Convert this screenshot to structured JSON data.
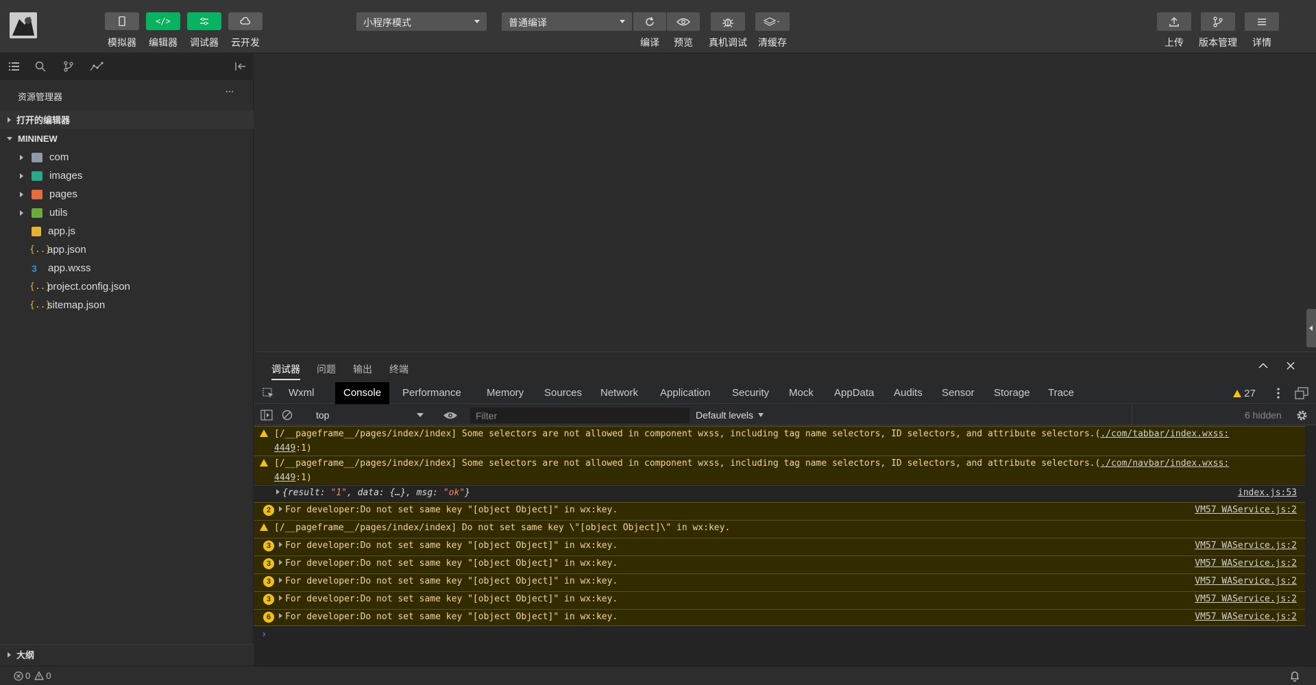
{
  "toolbar": {
    "left_buttons": [
      {
        "label": "模拟器",
        "icon": "phone-icon"
      },
      {
        "label": "编辑器",
        "icon": "code-icon"
      },
      {
        "label": "调试器",
        "icon": "debug-icon"
      },
      {
        "label": "云开发",
        "icon": "cloud-icon"
      }
    ],
    "mode_select": "小程序模式",
    "compile_select": "普通编译",
    "center_buttons": [
      {
        "label": "编译",
        "icon": "refresh-icon"
      },
      {
        "label": "预览",
        "icon": "eye-icon"
      },
      {
        "label": "真机调试",
        "icon": "bug-icon"
      },
      {
        "label": "清缓存",
        "icon": "layers-icon"
      }
    ],
    "right_buttons": [
      {
        "label": "上传",
        "icon": "upload-icon"
      },
      {
        "label": "版本管理",
        "icon": "branch-icon"
      },
      {
        "label": "详情",
        "icon": "menu-icon"
      }
    ]
  },
  "sidebar": {
    "title": "资源管理器",
    "more": "···",
    "open_editors": "打开的编辑器",
    "project": "MININEW",
    "items": [
      {
        "name": "com",
        "type": "folder"
      },
      {
        "name": "images",
        "type": "folder"
      },
      {
        "name": "pages",
        "type": "folder"
      },
      {
        "name": "utils",
        "type": "folder"
      },
      {
        "name": "app.js",
        "type": "js"
      },
      {
        "name": "app.json",
        "type": "json"
      },
      {
        "name": "app.wxss",
        "type": "wxss"
      },
      {
        "name": "project.config.json",
        "type": "json"
      },
      {
        "name": "sitemap.json",
        "type": "json"
      }
    ],
    "outline": "大纲"
  },
  "devtools": {
    "top_tabs": [
      "调试器",
      "问题",
      "输出",
      "终端"
    ],
    "tabs": [
      "Wxml",
      "Console",
      "Performance",
      "Memory",
      "Sources",
      "Network",
      "Application",
      "Security",
      "Mock",
      "AppData",
      "Audits",
      "Sensor",
      "Storage",
      "Trace"
    ],
    "warning_count": "27",
    "context": "top",
    "filter_placeholder": "Filter",
    "levels": "Default levels",
    "hidden": "6 hidden"
  },
  "console": {
    "messages": [
      {
        "kind": "warn",
        "text": "[/__pageframe__/pages/index/index] Some selectors are not allowed in component wxss, including tag name selectors, ID selectors, and attribute selectors.(",
        "link": "./com/tabbar/index.wxss:",
        "line2": "4449",
        "tail": ":1)"
      },
      {
        "kind": "warn",
        "text": "[/__pageframe__/pages/index/index] Some selectors are not allowed in component wxss, including tag name selectors, ID selectors, and attribute selectors.(",
        "link": "./com/navbar/index.wxss:",
        "line2": "4449",
        "tail": ":1)"
      },
      {
        "kind": "log",
        "obj_open": "{result: ",
        "result": "\"1\"",
        "mid": ", data: {…}, msg: ",
        "msg": "\"ok\"",
        "obj_close": "}",
        "src": "index.js:53"
      },
      {
        "kind": "group",
        "count": "2",
        "text": "For developer:Do not set same key \"[object Object]\" in wx:key.",
        "src": "VM57 WAService.js:2"
      },
      {
        "kind": "warn1",
        "text": "[/__pageframe__/pages/index/index] Do not set same key \\\"[object Object]\\\" in wx:key."
      },
      {
        "kind": "group",
        "count": "3",
        "text": "For developer:Do not set same key \"[object Object]\" in wx:key.",
        "src": "VM57 WAService.js:2"
      },
      {
        "kind": "group",
        "count": "3",
        "text": "For developer:Do not set same key \"[object Object]\" in wx:key.",
        "src": "VM57 WAService.js:2"
      },
      {
        "kind": "group",
        "count": "3",
        "text": "For developer:Do not set same key \"[object Object]\" in wx:key.",
        "src": "VM57 WAService.js:2"
      },
      {
        "kind": "group",
        "count": "3",
        "text": "For developer:Do not set same key \"[object Object]\" in wx:key.",
        "src": "VM57 WAService.js:2"
      },
      {
        "kind": "group",
        "count": "6",
        "text": "For developer:Do not set same key \"[object Object]\" in wx:key.",
        "src": "VM57 WAService.js:2"
      }
    ]
  },
  "status": {
    "errors": "0",
    "warnings": "0"
  },
  "colors": {
    "accent_green": "#08b35f",
    "warn_yellow": "#f4c20d",
    "warn_bg": "#332b00"
  }
}
